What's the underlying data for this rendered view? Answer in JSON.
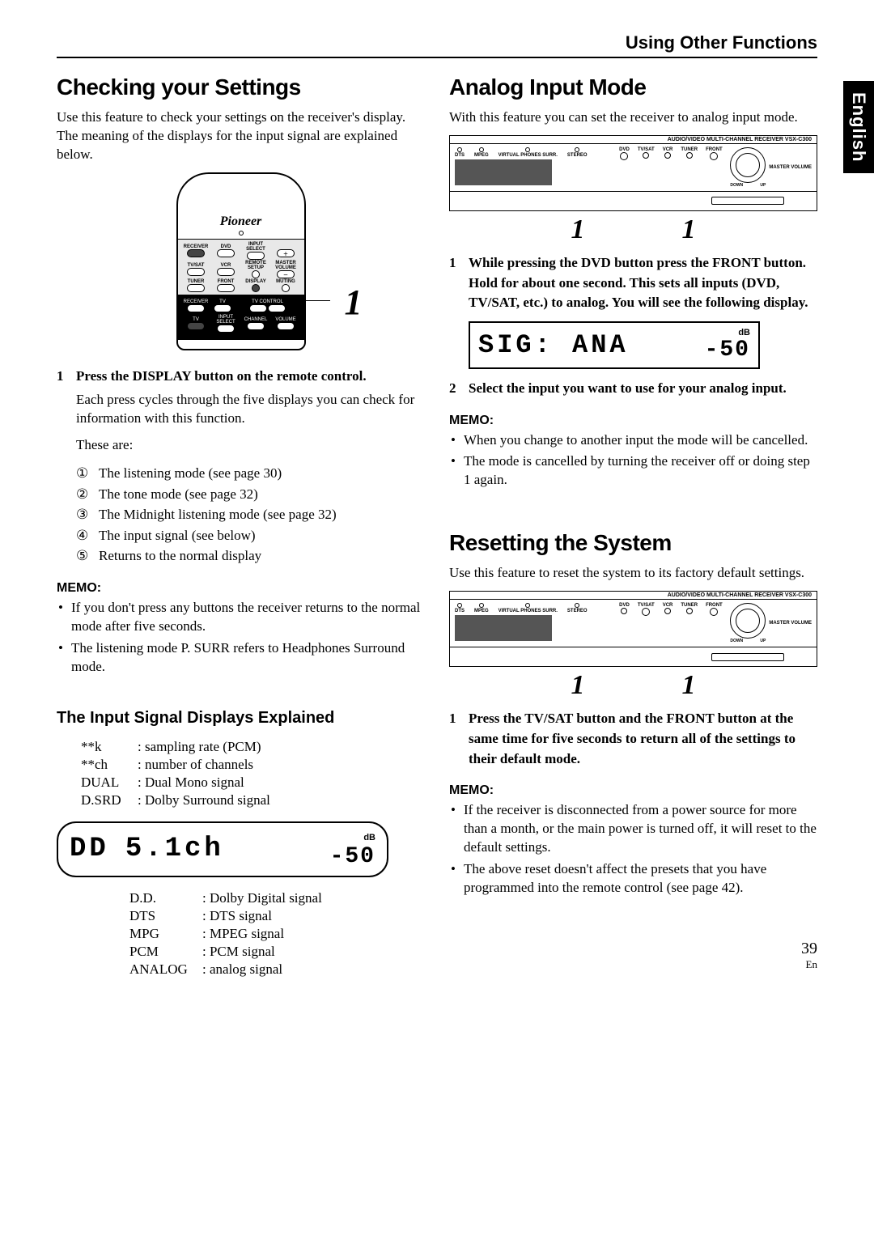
{
  "header": {
    "title": "Using Other Functions"
  },
  "sideTab": "English",
  "pageNumber": "39",
  "pageLang": "En",
  "left": {
    "title": "Checking your Settings",
    "intro": "Use this feature to check your settings on the receiver's display. The meaning of the displays for the input signal are explained below.",
    "remote": {
      "brand": "Pioneer",
      "rows": {
        "r1": {
          "a": "RECEIVER",
          "b": "DVD",
          "c": "INPUT SELECT"
        },
        "r2": {
          "a": "TV/SAT",
          "b": "VCR",
          "c": "REMOTE SETUP",
          "d": "MASTER VOLUME"
        },
        "r3": {
          "a": "TUNER",
          "b": "FRONT",
          "c": "DISPLAY",
          "d": "MUTING"
        },
        "r4": {
          "a": "RECEIVER",
          "b": "TV",
          "c": "TV CONTROL"
        },
        "r5": {
          "a": "TV",
          "b": "INPUT SELECT",
          "c": "CHANNEL",
          "d": "VOLUME"
        }
      },
      "callout": "1"
    },
    "step1": {
      "num": "1",
      "text_a": "Press the ",
      "bold": "DISPLAY",
      "text_b": " button on the remote control."
    },
    "step1_body": "Each press cycles through the five displays  you can check for information with this function.",
    "step1_lead": "These are:",
    "cycles": {
      "c1": {
        "n": "①",
        "t": "The listening mode (see page 30)"
      },
      "c2": {
        "n": "②",
        "t": "The tone mode (see page 32)"
      },
      "c3": {
        "n": "③",
        "t": "The Midnight listening mode (see page 32)"
      },
      "c4": {
        "n": "④",
        "t": "The input signal (see below)"
      },
      "c5": {
        "n": "⑤",
        "t": "Returns to the normal display"
      }
    },
    "memoLabel": "MEMO:",
    "memo": {
      "m1": "If you don't press any buttons the receiver returns to the normal mode after five seconds.",
      "m2": "The listening mode P. SURR refers to Headphones Surround mode."
    },
    "subheading": "The Input Signal Displays Explained",
    "upperLegend": {
      "r1": {
        "k": "**k",
        "v": ": sampling rate (PCM)"
      },
      "r2": {
        "k": "**ch",
        "v": ": number of channels"
      },
      "r3": {
        "k": "DUAL",
        "v": ": Dual Mono signal"
      },
      "r4": {
        "k": "D.SRD",
        "v": ": Dolby Surround signal"
      }
    },
    "displayBox": {
      "seg1": "DD",
      "seg2": "5.1ch",
      "dbLabel": "dB",
      "dbVal": "-50"
    },
    "lowerLegend": {
      "r1": {
        "k": "D.D.",
        "v": ": Dolby Digital signal"
      },
      "r2": {
        "k": "DTS",
        "v": ": DTS signal"
      },
      "r3": {
        "k": "MPG",
        "v": ": MPEG signal"
      },
      "r4": {
        "k": "PCM",
        "v": ": PCM signal"
      },
      "r5": {
        "k": "ANALOG",
        "v": ": analog signal"
      }
    }
  },
  "right": {
    "analog": {
      "title": "Analog Input Mode",
      "intro": "With this feature you can set the receiver to analog input mode.",
      "receiver": {
        "model": "AUDIO/VIDEO MULTI-CHANNEL RECEIVER  VSX-C300",
        "leds": {
          "a": "DTS",
          "b": "MPEG",
          "c": "VIRTUAL PHONES SURR.",
          "d": "STEREO"
        },
        "buttons": {
          "b1": "DVD",
          "b2": "TV/SAT",
          "b3": "VCR",
          "b4": "TUNER",
          "b5": "FRONT"
        },
        "knob": {
          "left": "DOWN",
          "right": "UP",
          "label": "MASTER VOLUME"
        }
      },
      "callouts": {
        "a": "1",
        "b": "1"
      },
      "step1": {
        "num": "1",
        "text": "While pressing the DVD button press the FRONT button. Hold for about one second. This sets all inputs (DVD, TV/SAT, etc.) to analog. You will see the following display."
      },
      "sig": {
        "main": "SIG: ANA",
        "dbLabel": "dB",
        "dbVal": "-50"
      },
      "step2": {
        "num": "2",
        "text": "Select the input you want to use for your analog input."
      },
      "memoLabel": "MEMO:",
      "memo": {
        "m1": "When you change to another input the mode will be cancelled.",
        "m2": "The mode is cancelled by turning the receiver off or doing step 1 again."
      }
    },
    "reset": {
      "title": "Resetting the System",
      "intro": "Use this feature to reset the system to its factory default settings.",
      "callouts": {
        "a": "1",
        "b": "1"
      },
      "step1": {
        "num": "1",
        "text": "Press the TV/SAT button and the  FRONT button at the same time for five seconds to return all of the settings to their default mode."
      },
      "memoLabel": "MEMO:",
      "memo": {
        "m1": "If the receiver is disconnected from a power source for more than a month, or the main power is turned off, it will reset to the default settings.",
        "m2": "The above reset doesn't affect the presets that you have programmed into the remote control (see page 42)."
      }
    }
  }
}
